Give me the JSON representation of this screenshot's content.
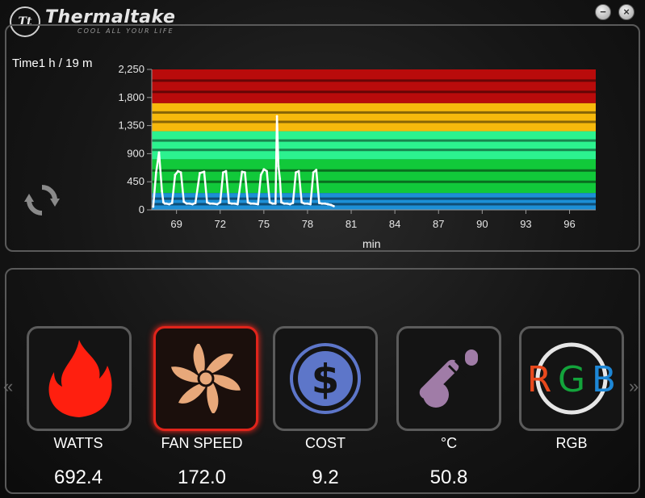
{
  "header": {
    "logo_badge": "Tt",
    "brand": "Thermaltake",
    "tagline": "COOL ALL YOUR LIFE",
    "minimize_glyph": "−",
    "close_glyph": "×"
  },
  "monitor": {
    "time_text": "Time1 h / 19 m"
  },
  "chart_data": {
    "type": "line",
    "xlabel": "min",
    "ylabel": "",
    "xlim": [
      67.3,
      97.8
    ],
    "ylim": [
      0,
      2250
    ],
    "yticks": [
      0,
      450,
      900,
      1350,
      1800,
      2250
    ],
    "ytick_labels": [
      "0",
      "450",
      "900",
      "1,350",
      "1,800",
      "2,250"
    ],
    "xticks": [
      69,
      72,
      75,
      78,
      81,
      84,
      87,
      90,
      93,
      96
    ],
    "grid": true,
    "bands": [
      {
        "from": 0,
        "to": 270,
        "color": "#1c8fd6"
      },
      {
        "from": 270,
        "to": 810,
        "color": "#11c93a"
      },
      {
        "from": 810,
        "to": 1260,
        "color": "#2cf28f"
      },
      {
        "from": 1260,
        "to": 1710,
        "color": "#f7b90c"
      },
      {
        "from": 1710,
        "to": 2250,
        "color": "#b90b0b"
      }
    ],
    "series": [
      {
        "color": "#ffffff",
        "x": [
          67.4,
          67.6,
          67.8,
          68.0,
          68.1,
          68.2,
          68.3,
          68.5,
          68.7,
          68.9,
          69.1,
          69.3,
          69.5,
          69.7,
          69.9,
          70.1,
          70.3,
          70.6,
          70.9,
          71.1,
          71.3,
          71.5,
          71.8,
          72.0,
          72.2,
          72.4,
          72.6,
          72.8,
          73.0,
          73.2,
          73.5,
          73.7,
          73.9,
          74.1,
          74.3,
          74.6,
          74.8,
          75.0,
          75.2,
          75.4,
          75.6,
          75.8,
          75.9,
          76.0,
          76.1,
          76.2,
          76.4,
          76.6,
          76.8,
          77.0,
          77.2,
          77.4,
          77.6,
          77.8,
          78.0,
          78.2,
          78.4,
          78.6,
          78.8,
          79.0,
          79.2,
          79.4,
          79.6,
          79.8
        ],
        "y": [
          50,
          600,
          920,
          300,
          120,
          100,
          100,
          90,
          110,
          560,
          620,
          600,
          130,
          100,
          100,
          90,
          110,
          590,
          610,
          120,
          100,
          100,
          90,
          120,
          600,
          620,
          110,
          100,
          100,
          90,
          610,
          600,
          120,
          100,
          100,
          90,
          560,
          650,
          620,
          120,
          100,
          100,
          1500,
          700,
          500,
          120,
          100,
          100,
          90,
          110,
          600,
          620,
          120,
          100,
          100,
          90,
          600,
          640,
          110,
          100,
          100,
          90,
          80,
          60
        ]
      }
    ]
  },
  "tiles": [
    {
      "label": "WATTS",
      "value": "692.4",
      "icon": "flame-icon",
      "color": "#ff1f0f"
    },
    {
      "label": "FAN SPEED",
      "value": "172.0",
      "icon": "fan-icon",
      "color": "#e8a87a"
    },
    {
      "label": "COST",
      "value": "9.2",
      "icon": "dollar-icon",
      "color": "#5d76c9"
    },
    {
      "label": "°C",
      "value": "50.8",
      "icon": "thermometer-icon",
      "color": "#a07ca7"
    },
    {
      "label": "RGB",
      "value": "",
      "icon": "rgb-icon",
      "rgb_letters": [
        "R",
        "G",
        "B"
      ],
      "rgb_colors": [
        "#e8491d",
        "#13a33b",
        "#1d87d6"
      ]
    }
  ],
  "nav": {
    "prev_glyph": "«",
    "next_glyph": "»"
  }
}
